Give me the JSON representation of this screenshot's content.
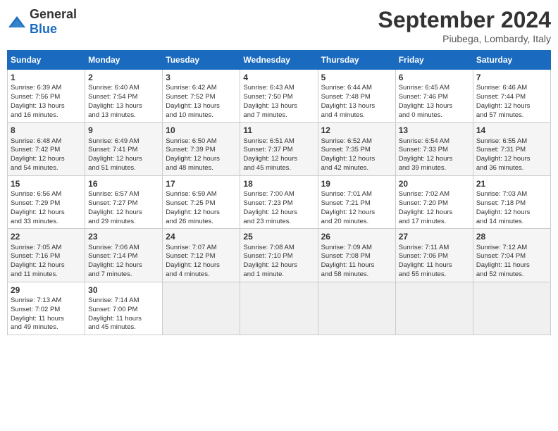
{
  "header": {
    "logo_general": "General",
    "logo_blue": "Blue",
    "month": "September 2024",
    "location": "Piubega, Lombardy, Italy"
  },
  "days_of_week": [
    "Sunday",
    "Monday",
    "Tuesday",
    "Wednesday",
    "Thursday",
    "Friday",
    "Saturday"
  ],
  "weeks": [
    [
      {
        "day": "1",
        "lines": [
          "Sunrise: 6:39 AM",
          "Sunset: 7:56 PM",
          "Daylight: 13 hours",
          "and 16 minutes."
        ]
      },
      {
        "day": "2",
        "lines": [
          "Sunrise: 6:40 AM",
          "Sunset: 7:54 PM",
          "Daylight: 13 hours",
          "and 13 minutes."
        ]
      },
      {
        "day": "3",
        "lines": [
          "Sunrise: 6:42 AM",
          "Sunset: 7:52 PM",
          "Daylight: 13 hours",
          "and 10 minutes."
        ]
      },
      {
        "day": "4",
        "lines": [
          "Sunrise: 6:43 AM",
          "Sunset: 7:50 PM",
          "Daylight: 13 hours",
          "and 7 minutes."
        ]
      },
      {
        "day": "5",
        "lines": [
          "Sunrise: 6:44 AM",
          "Sunset: 7:48 PM",
          "Daylight: 13 hours",
          "and 4 minutes."
        ]
      },
      {
        "day": "6",
        "lines": [
          "Sunrise: 6:45 AM",
          "Sunset: 7:46 PM",
          "Daylight: 13 hours",
          "and 0 minutes."
        ]
      },
      {
        "day": "7",
        "lines": [
          "Sunrise: 6:46 AM",
          "Sunset: 7:44 PM",
          "Daylight: 12 hours",
          "and 57 minutes."
        ]
      }
    ],
    [
      {
        "day": "8",
        "lines": [
          "Sunrise: 6:48 AM",
          "Sunset: 7:42 PM",
          "Daylight: 12 hours",
          "and 54 minutes."
        ]
      },
      {
        "day": "9",
        "lines": [
          "Sunrise: 6:49 AM",
          "Sunset: 7:41 PM",
          "Daylight: 12 hours",
          "and 51 minutes."
        ]
      },
      {
        "day": "10",
        "lines": [
          "Sunrise: 6:50 AM",
          "Sunset: 7:39 PM",
          "Daylight: 12 hours",
          "and 48 minutes."
        ]
      },
      {
        "day": "11",
        "lines": [
          "Sunrise: 6:51 AM",
          "Sunset: 7:37 PM",
          "Daylight: 12 hours",
          "and 45 minutes."
        ]
      },
      {
        "day": "12",
        "lines": [
          "Sunrise: 6:52 AM",
          "Sunset: 7:35 PM",
          "Daylight: 12 hours",
          "and 42 minutes."
        ]
      },
      {
        "day": "13",
        "lines": [
          "Sunrise: 6:54 AM",
          "Sunset: 7:33 PM",
          "Daylight: 12 hours",
          "and 39 minutes."
        ]
      },
      {
        "day": "14",
        "lines": [
          "Sunrise: 6:55 AM",
          "Sunset: 7:31 PM",
          "Daylight: 12 hours",
          "and 36 minutes."
        ]
      }
    ],
    [
      {
        "day": "15",
        "lines": [
          "Sunrise: 6:56 AM",
          "Sunset: 7:29 PM",
          "Daylight: 12 hours",
          "and 33 minutes."
        ]
      },
      {
        "day": "16",
        "lines": [
          "Sunrise: 6:57 AM",
          "Sunset: 7:27 PM",
          "Daylight: 12 hours",
          "and 29 minutes."
        ]
      },
      {
        "day": "17",
        "lines": [
          "Sunrise: 6:59 AM",
          "Sunset: 7:25 PM",
          "Daylight: 12 hours",
          "and 26 minutes."
        ]
      },
      {
        "day": "18",
        "lines": [
          "Sunrise: 7:00 AM",
          "Sunset: 7:23 PM",
          "Daylight: 12 hours",
          "and 23 minutes."
        ]
      },
      {
        "day": "19",
        "lines": [
          "Sunrise: 7:01 AM",
          "Sunset: 7:21 PM",
          "Daylight: 12 hours",
          "and 20 minutes."
        ]
      },
      {
        "day": "20",
        "lines": [
          "Sunrise: 7:02 AM",
          "Sunset: 7:20 PM",
          "Daylight: 12 hours",
          "and 17 minutes."
        ]
      },
      {
        "day": "21",
        "lines": [
          "Sunrise: 7:03 AM",
          "Sunset: 7:18 PM",
          "Daylight: 12 hours",
          "and 14 minutes."
        ]
      }
    ],
    [
      {
        "day": "22",
        "lines": [
          "Sunrise: 7:05 AM",
          "Sunset: 7:16 PM",
          "Daylight: 12 hours",
          "and 11 minutes."
        ]
      },
      {
        "day": "23",
        "lines": [
          "Sunrise: 7:06 AM",
          "Sunset: 7:14 PM",
          "Daylight: 12 hours",
          "and 7 minutes."
        ]
      },
      {
        "day": "24",
        "lines": [
          "Sunrise: 7:07 AM",
          "Sunset: 7:12 PM",
          "Daylight: 12 hours",
          "and 4 minutes."
        ]
      },
      {
        "day": "25",
        "lines": [
          "Sunrise: 7:08 AM",
          "Sunset: 7:10 PM",
          "Daylight: 12 hours",
          "and 1 minute."
        ]
      },
      {
        "day": "26",
        "lines": [
          "Sunrise: 7:09 AM",
          "Sunset: 7:08 PM",
          "Daylight: 11 hours",
          "and 58 minutes."
        ]
      },
      {
        "day": "27",
        "lines": [
          "Sunrise: 7:11 AM",
          "Sunset: 7:06 PM",
          "Daylight: 11 hours",
          "and 55 minutes."
        ]
      },
      {
        "day": "28",
        "lines": [
          "Sunrise: 7:12 AM",
          "Sunset: 7:04 PM",
          "Daylight: 11 hours",
          "and 52 minutes."
        ]
      }
    ],
    [
      {
        "day": "29",
        "lines": [
          "Sunrise: 7:13 AM",
          "Sunset: 7:02 PM",
          "Daylight: 11 hours",
          "and 49 minutes."
        ]
      },
      {
        "day": "30",
        "lines": [
          "Sunrise: 7:14 AM",
          "Sunset: 7:00 PM",
          "Daylight: 11 hours",
          "and 45 minutes."
        ]
      },
      null,
      null,
      null,
      null,
      null
    ]
  ]
}
